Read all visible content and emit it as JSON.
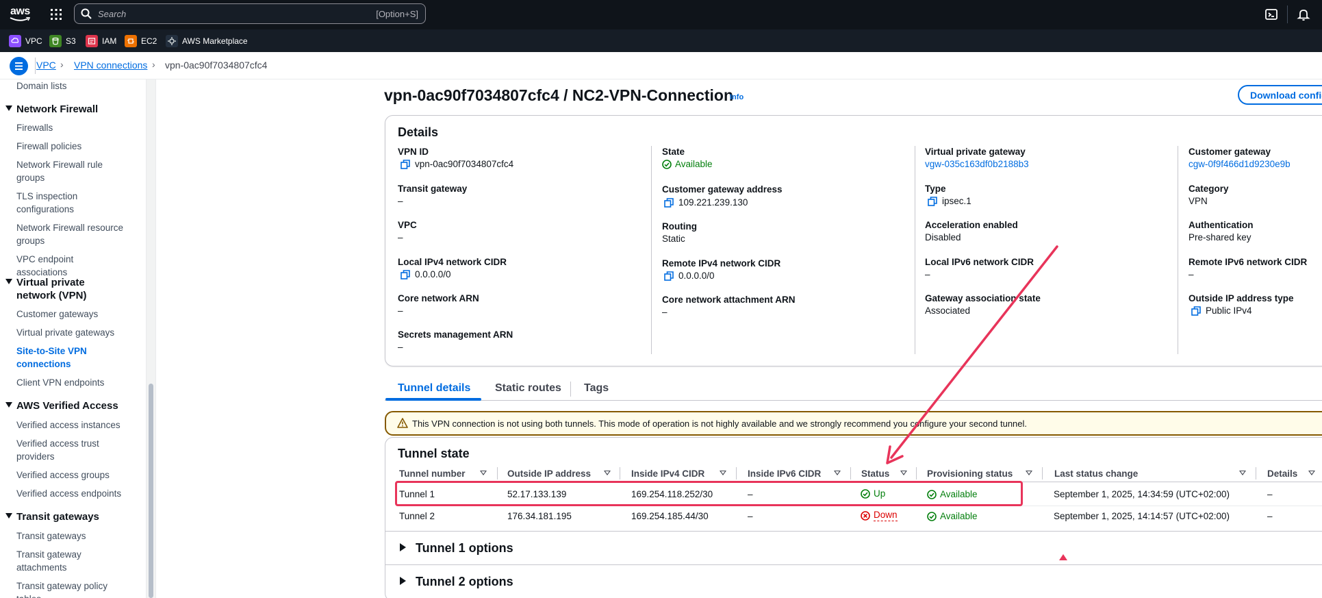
{
  "topbar": {
    "logo_text": "aws",
    "search_placeholder": "Search",
    "search_shortcut": "[Option+S]",
    "icons": [
      "grid-icon",
      "search-icon",
      "cloudshell-icon",
      "bell-icon"
    ]
  },
  "favorites": [
    {
      "label": "VPC",
      "color": "#8c4fff"
    },
    {
      "label": "S3",
      "color": "#3f8624"
    },
    {
      "label": "IAM",
      "color": "#dd344c"
    },
    {
      "label": "EC2",
      "color": "#ed7100"
    },
    {
      "label": "AWS Marketplace",
      "color": "#232f3e"
    }
  ],
  "breadcrumb": {
    "items": [
      "VPC",
      "VPN connections"
    ],
    "current": "vpn-0ac90f7034807cfc4"
  },
  "sidebar": {
    "top_item": "Domain lists",
    "sections": [
      {
        "title": "Network Firewall",
        "items": [
          "Firewalls",
          "Firewall policies",
          "Network Firewall rule groups",
          "TLS inspection configurations",
          "Network Firewall resource groups",
          "VPC endpoint associations"
        ]
      },
      {
        "title": "Virtual private network (VPN)",
        "items": [
          "Customer gateways",
          "Virtual private gateways",
          "Site-to-Site VPN connections",
          "Client VPN endpoints"
        ],
        "active": "Site-to-Site VPN connections"
      },
      {
        "title": "AWS Verified Access",
        "items": [
          "Verified access instances",
          "Verified access trust providers",
          "Verified access groups",
          "Verified access endpoints"
        ]
      },
      {
        "title": "Transit gateways",
        "items": [
          "Transit gateways",
          "Transit gateway attachments",
          "Transit gateway policy tables"
        ]
      }
    ]
  },
  "page": {
    "title": "vpn-0ac90f7034807cfc4 / NC2-VPN-Connection",
    "info": "Info",
    "download_button": "Download configuration"
  },
  "details": {
    "title": "Details",
    "col1": [
      {
        "k": "VPN ID",
        "v": "vpn-0ac90f7034807cfc4"
      },
      {
        "k": "Transit gateway",
        "v": "–"
      },
      {
        "k": "VPC",
        "v": "–"
      },
      {
        "k": "Local IPv4 network CIDR",
        "v": "0.0.0.0/0"
      },
      {
        "k": "Core network ARN",
        "v": "–"
      },
      {
        "k": "Secrets management ARN",
        "v": "–"
      }
    ],
    "col2": [
      {
        "k": "State",
        "v": "Available"
      },
      {
        "k": "Customer gateway address",
        "v": "109.221.239.130"
      },
      {
        "k": "Routing",
        "v": "Static"
      },
      {
        "k": "Remote IPv4 network CIDR",
        "v": "0.0.0.0/0"
      },
      {
        "k": "Core network attachment ARN",
        "v": "–"
      }
    ],
    "col3": [
      {
        "k": "Virtual private gateway",
        "v": "vgw-035c163df0b2188b3"
      },
      {
        "k": "Type",
        "v": "ipsec.1"
      },
      {
        "k": "Acceleration enabled",
        "v": "Disabled"
      },
      {
        "k": "Local IPv6 network CIDR",
        "v": "–"
      },
      {
        "k": "Gateway association state",
        "v": "Associated"
      }
    ],
    "col4": [
      {
        "k": "Customer gateway",
        "v": "cgw-0f9f466d1d9230e9b"
      },
      {
        "k": "Category",
        "v": "VPN"
      },
      {
        "k": "Authentication",
        "v": "Pre-shared key"
      },
      {
        "k": "Remote IPv6 network CIDR",
        "v": "–"
      },
      {
        "k": "Outside IP address type",
        "v": "Public IPv4"
      }
    ]
  },
  "tabs": [
    "Tunnel details",
    "Static routes",
    "Tags"
  ],
  "alert": {
    "text": "This VPN connection is not using both tunnels. This mode of operation is not highly available and we strongly recommend you configure your second tunnel."
  },
  "tunnel_state": {
    "title": "Tunnel state",
    "columns": [
      "Tunnel number",
      "Outside IP address",
      "Inside IPv4 CIDR",
      "Inside IPv6 CIDR",
      "Status",
      "Provisioning status",
      "Last status change",
      "Details"
    ],
    "rows": [
      [
        "Tunnel 1",
        "52.17.133.139",
        "169.254.118.252/30",
        "–",
        "Up",
        "Available",
        "September 1, 2025, 14:34:59 (UTC+02:00)",
        "–"
      ],
      [
        "Tunnel 2",
        "176.34.181.195",
        "169.254.185.44/30",
        "–",
        "Down",
        "Available",
        "September 1, 2025, 14:14:57 (UTC+02:00)",
        "–"
      ]
    ]
  },
  "expanders": [
    "Tunnel 1 options",
    "Tunnel 2 options"
  ],
  "colors": {
    "accent": "#006ce0",
    "success": "#037f0c",
    "error": "#db0000",
    "annotation": "#e8345a"
  }
}
